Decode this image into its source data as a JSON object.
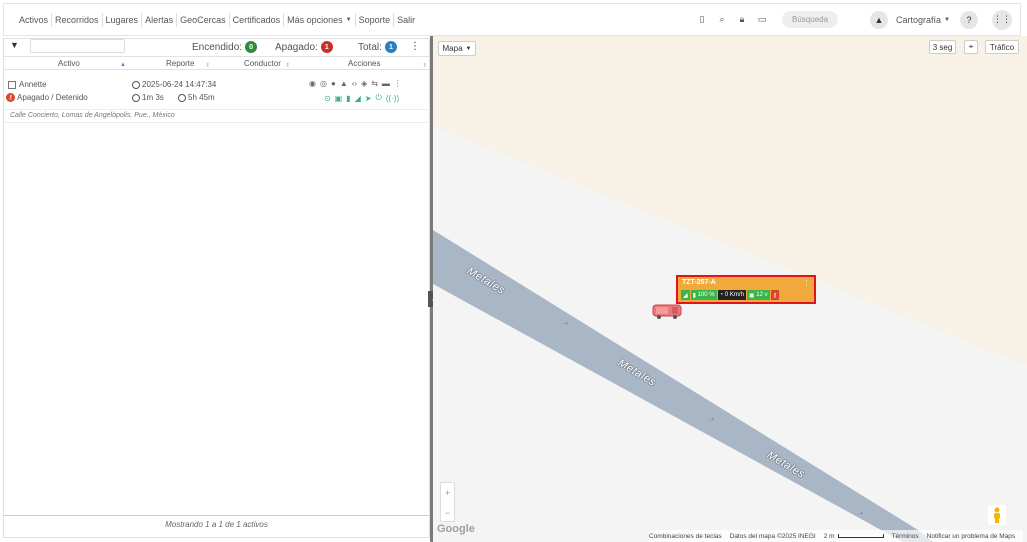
{
  "nav": {
    "items": [
      "Activos",
      "Recorridos",
      "Lugares",
      "Alertas",
      "GeoCercas",
      "Certificados",
      "Más opciones",
      "Soporte",
      "Salir"
    ],
    "search_placeholder": "Búsqueda",
    "cartografia": "Cartografía"
  },
  "left": {
    "stats": {
      "encendido_label": "Encendido:",
      "encendido_count": "0",
      "apagado_label": "Apagado:",
      "apagado_count": "1",
      "total_label": "Total:",
      "total_count": "1"
    },
    "columns": [
      "Activo",
      "Reporte",
      "Conductor",
      "Acciones"
    ],
    "row": {
      "name": "Annette",
      "status": "Apagado / Detenido",
      "report_time": "2025-06-24 14:47:34",
      "duration1": "1m 3s",
      "duration2": "5h 45m",
      "address": "Calle Concierto, Lomas de Angelópolis, Pue., México"
    },
    "footer": "Mostrando 1 a 1 de 1 activos"
  },
  "map": {
    "type_button": "Mapa",
    "refresh_button": "3 seg",
    "traffic_button": "Tráfico",
    "road_labels": [
      "Metales",
      "Metales",
      "Metales"
    ],
    "vehicle": {
      "plate": "TZT-257-A",
      "battery": "100 %",
      "speed": "0 Km/h",
      "voltage": "12 v"
    },
    "colors": {
      "card_bg": "#f0a93a",
      "card_border": "#e0141e",
      "chip_green": "#39b54a",
      "chip_dark": "#222222",
      "chip_red": "#d9452a",
      "road": "#a9b6c6"
    },
    "google": "Google",
    "attribution": [
      "Combinaciones de teclas",
      "Datos del mapa ©2025 INEGI",
      "2 m",
      "Términos",
      "Notificar un problema de Maps"
    ]
  }
}
